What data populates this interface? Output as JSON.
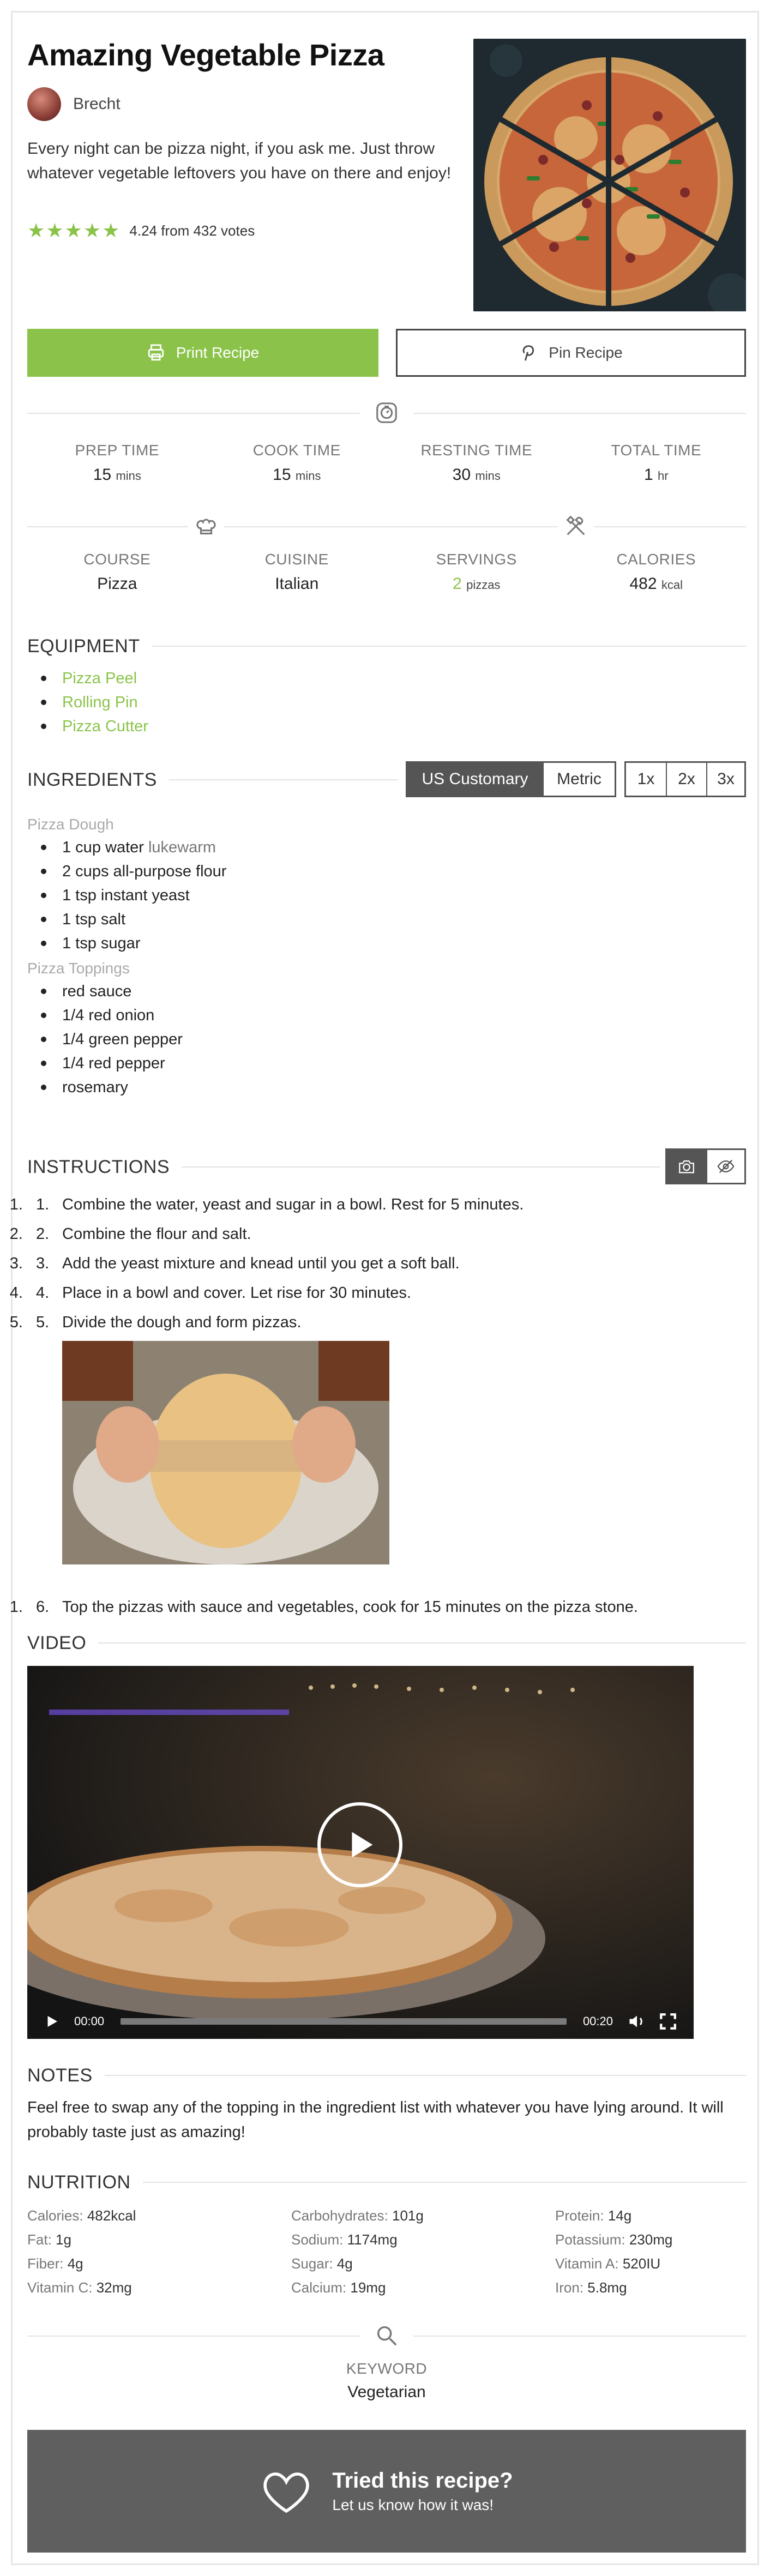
{
  "recipe": {
    "title": "Amazing Vegetable Pizza",
    "author": "Brecht",
    "summary": "Every night can be pizza night, if you ask me. Just throw whatever vegetable leftovers you have on there and enjoy!",
    "rating": {
      "stars": 5,
      "text": "4.24 from 432 votes",
      "color": "#8bc34a"
    }
  },
  "buttons": {
    "print": "Print Recipe",
    "pin": "Pin Recipe"
  },
  "times": [
    {
      "label": "PREP TIME",
      "value": "15",
      "unit": "mins"
    },
    {
      "label": "COOK TIME",
      "value": "15",
      "unit": "mins"
    },
    {
      "label": "RESTING TIME",
      "value": "30",
      "unit": "mins"
    },
    {
      "label": "TOTAL TIME",
      "value": "1",
      "unit": "hr"
    }
  ],
  "details": [
    {
      "label": "COURSE",
      "value": "Pizza",
      "unit": ""
    },
    {
      "label": "CUISINE",
      "value": "Italian",
      "unit": ""
    },
    {
      "label": "SERVINGS",
      "value": "2",
      "unit": "pizzas"
    },
    {
      "label": "CALORIES",
      "value": "482",
      "unit": "kcal"
    }
  ],
  "equipment": {
    "title": "EQUIPMENT",
    "items": [
      "Pizza Peel",
      "Rolling Pin",
      "Pizza Cutter"
    ]
  },
  "ingredients": {
    "title": "INGREDIENTS",
    "units": [
      "US Customary",
      "Metric"
    ],
    "active_unit": "US Customary",
    "multipliers": [
      "1x",
      "2x",
      "3x"
    ],
    "groups": [
      {
        "name": "Pizza Dough",
        "items": [
          {
            "text": "1 cup water",
            "note": "lukewarm"
          },
          {
            "text": "2 cups all-purpose flour",
            "note": ""
          },
          {
            "text": "1 tsp instant yeast",
            "note": ""
          },
          {
            "text": "1 tsp salt",
            "note": ""
          },
          {
            "text": "1 tsp sugar",
            "note": ""
          }
        ]
      },
      {
        "name": "Pizza Toppings",
        "items": [
          {
            "text": "red sauce",
            "note": ""
          },
          {
            "text": "1/4 red onion",
            "note": ""
          },
          {
            "text": "1/4 green pepper",
            "note": ""
          },
          {
            "text": "1/4 red pepper",
            "note": ""
          },
          {
            "text": "rosemary",
            "note": ""
          }
        ]
      }
    ]
  },
  "instructions": {
    "title": "INSTRUCTIONS",
    "steps": [
      "Combine the water, yeast and sugar in a bowl. Rest for 5 minutes.",
      "Combine the flour and salt.",
      "Add the yeast mixture and knead until you get a soft ball.",
      "Place in a bowl and cover. Let rise for 30 minutes.",
      "Divide the dough and form pizzas.",
      "Top the pizzas with sauce and vegetables, cook for 15 minutes on the pizza stone."
    ]
  },
  "video": {
    "title": "VIDEO",
    "current_time": "00:00",
    "duration": "00:20"
  },
  "notes": {
    "title": "NOTES",
    "text": "Feel free to swap any of the topping in the ingredient list with whatever you have lying around. It will probably taste just as amazing!"
  },
  "nutrition": {
    "title": "NUTRITION",
    "items": [
      {
        "label": "Calories:",
        "value": "482kcal"
      },
      {
        "label": "Carbohydrates:",
        "value": "101g"
      },
      {
        "label": "Protein:",
        "value": "14g"
      },
      {
        "label": "Fat:",
        "value": "1g"
      },
      {
        "label": "Sodium:",
        "value": "1174mg"
      },
      {
        "label": "Potassium:",
        "value": "230mg"
      },
      {
        "label": "Fiber:",
        "value": "4g"
      },
      {
        "label": "Sugar:",
        "value": "4g"
      },
      {
        "label": "Vitamin A:",
        "value": "520IU"
      },
      {
        "label": "Vitamin C:",
        "value": "32mg"
      },
      {
        "label": "Calcium:",
        "value": "19mg"
      },
      {
        "label": "Iron:",
        "value": "5.8mg"
      }
    ]
  },
  "keyword": {
    "label": "KEYWORD",
    "value": "Vegetarian"
  },
  "cta": {
    "title": "Tried this recipe?",
    "subtitle": "Let us know how it was!"
  },
  "icons": [
    "printer-icon",
    "pinterest-icon",
    "timer-icon",
    "chef-hat-icon",
    "utensils-icon",
    "camera-icon",
    "eye-off-icon",
    "play-icon",
    "volume-icon",
    "fullscreen-icon",
    "search-icon",
    "heart-icon"
  ]
}
